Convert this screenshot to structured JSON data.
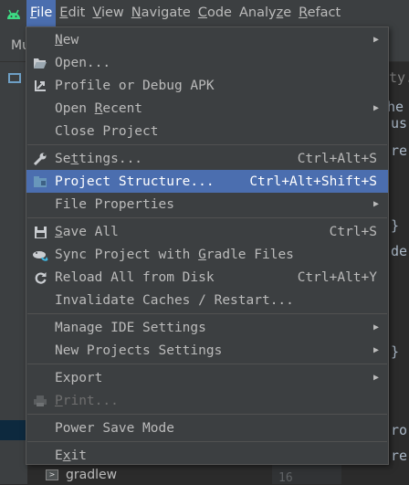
{
  "menubar": {
    "items": [
      {
        "label": "File",
        "mnemonic_index": 0
      },
      {
        "label": "Edit",
        "mnemonic_index": 0
      },
      {
        "label": "View",
        "mnemonic_index": 0
      },
      {
        "label": "Navigate",
        "mnemonic_index": 0
      },
      {
        "label": "Code",
        "mnemonic_index": 0
      },
      {
        "label": "Analyze",
        "mnemonic_index": 5
      },
      {
        "label": "Refact",
        "mnemonic_index": 0
      }
    ]
  },
  "background": {
    "tab_label": "Mu",
    "tree_item": "gradlew",
    "line_number": "16",
    "editor_lines": [
      "ty.",
      "he",
      "us",
      "re",
      "}",
      "de",
      "}",
      "ro",
      "re"
    ]
  },
  "menu": {
    "items": [
      {
        "type": "item",
        "pre": "",
        "mn": "N",
        "post": "ew",
        "shortcut": "",
        "submenu": true
      },
      {
        "type": "item",
        "pre": "Open...",
        "mn": "",
        "post": "",
        "shortcut": "",
        "submenu": false,
        "icon": "folder-open-icon"
      },
      {
        "type": "item",
        "pre": "Profile or Debug APK",
        "mn": "",
        "post": "",
        "shortcut": "",
        "submenu": false,
        "icon": "profile-apk-icon"
      },
      {
        "type": "item",
        "pre": "Open ",
        "mn": "R",
        "post": "ecent",
        "shortcut": "",
        "submenu": true
      },
      {
        "type": "item",
        "pre": "Close Project",
        "mn": "",
        "post": "",
        "shortcut": "",
        "submenu": false
      },
      {
        "type": "sep"
      },
      {
        "type": "item",
        "pre": "Se",
        "mn": "t",
        "post": "tings...",
        "shortcut": "Ctrl+Alt+S",
        "submenu": false,
        "icon": "wrench-icon"
      },
      {
        "type": "item",
        "pre": "Project Structure...",
        "mn": "",
        "post": "",
        "shortcut": "Ctrl+Alt+Shift+S",
        "submenu": false,
        "icon": "project-structure-icon",
        "selected": true
      },
      {
        "type": "item",
        "pre": "File Properties",
        "mn": "",
        "post": "",
        "shortcut": "",
        "submenu": true
      },
      {
        "type": "sep"
      },
      {
        "type": "item",
        "pre": "",
        "mn": "S",
        "post": "ave All",
        "shortcut": "Ctrl+S",
        "submenu": false,
        "icon": "save-icon"
      },
      {
        "type": "item",
        "pre": "Sync Project with ",
        "mn": "G",
        "post": "radle Files",
        "shortcut": "",
        "submenu": false,
        "icon": "gradle-sync-icon"
      },
      {
        "type": "item",
        "pre": "Reload All from Disk",
        "mn": "",
        "post": "",
        "shortcut": "Ctrl+Alt+Y",
        "submenu": false,
        "icon": "reload-icon"
      },
      {
        "type": "item",
        "pre": "Invalidate Caches / Restart...",
        "mn": "",
        "post": "",
        "shortcut": "",
        "submenu": false
      },
      {
        "type": "sep"
      },
      {
        "type": "item",
        "pre": "Manage IDE Settings",
        "mn": "",
        "post": "",
        "shortcut": "",
        "submenu": true
      },
      {
        "type": "item",
        "pre": "New Projects Settings",
        "mn": "",
        "post": "",
        "shortcut": "",
        "submenu": true
      },
      {
        "type": "sep"
      },
      {
        "type": "item",
        "pre": "Export",
        "mn": "",
        "post": "",
        "shortcut": "",
        "submenu": true
      },
      {
        "type": "item",
        "pre": "",
        "mn": "P",
        "post": "rint...",
        "shortcut": "",
        "submenu": false,
        "icon": "printer-icon",
        "disabled": true
      },
      {
        "type": "sep"
      },
      {
        "type": "item",
        "pre": "Power Save Mode",
        "mn": "",
        "post": "",
        "shortcut": "",
        "submenu": false
      },
      {
        "type": "sep"
      },
      {
        "type": "item",
        "pre": "E",
        "mn": "x",
        "post": "it",
        "shortcut": "",
        "submenu": false
      }
    ]
  },
  "colors": {
    "selection": "#4b6eaf",
    "menu_bg": "#3c3f41",
    "android_green": "#3ddc84"
  }
}
